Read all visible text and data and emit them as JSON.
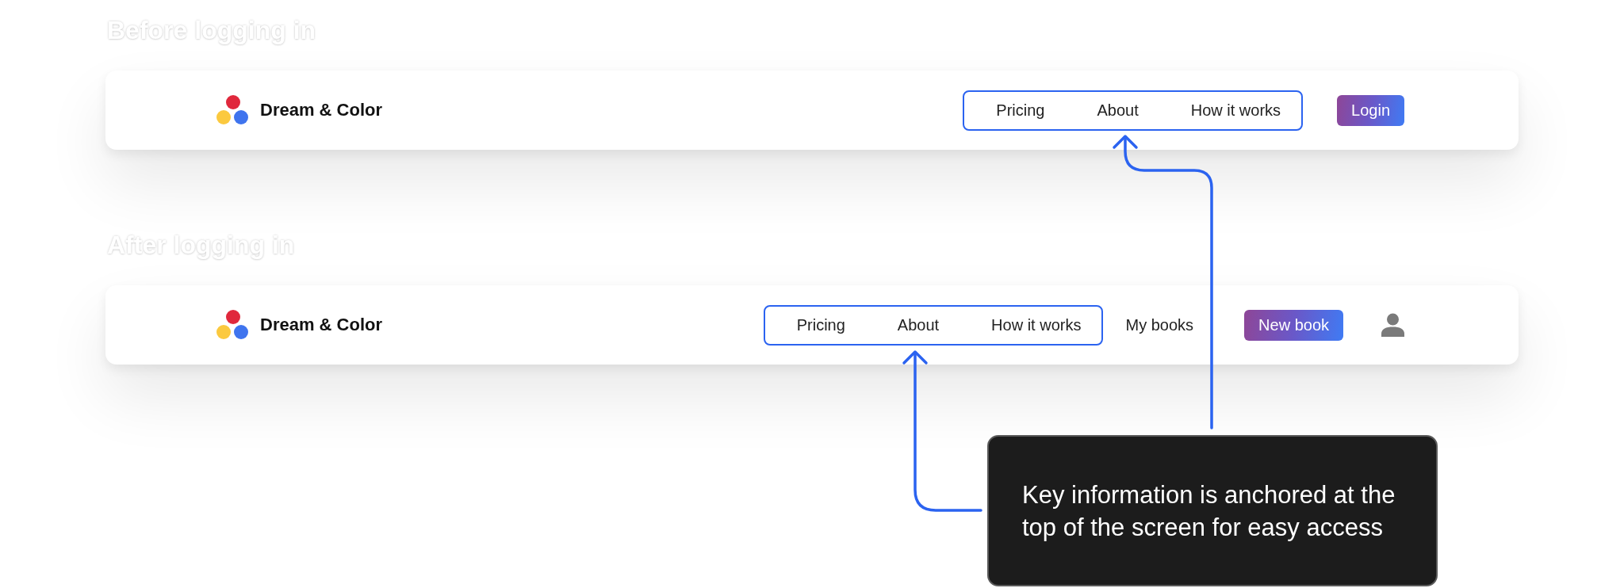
{
  "sections": [
    {
      "heading": "Before logging in",
      "navbar": {
        "brand": "Dream & Color",
        "nav_links": [
          "Pricing",
          "About",
          "How it works"
        ],
        "items": [
          {
            "kind": "button",
            "label": "Login"
          }
        ]
      }
    },
    {
      "heading": "After logging in",
      "navbar": {
        "brand": "Dream & Color",
        "nav_links": [
          "Pricing",
          "About",
          "How it works"
        ],
        "items": [
          {
            "kind": "link",
            "label": "My books"
          },
          {
            "kind": "button",
            "label": "New book"
          },
          {
            "kind": "avatar"
          }
        ]
      }
    }
  ],
  "callout": {
    "text": "Key information is anchored at the top of the screen for easy access"
  }
}
